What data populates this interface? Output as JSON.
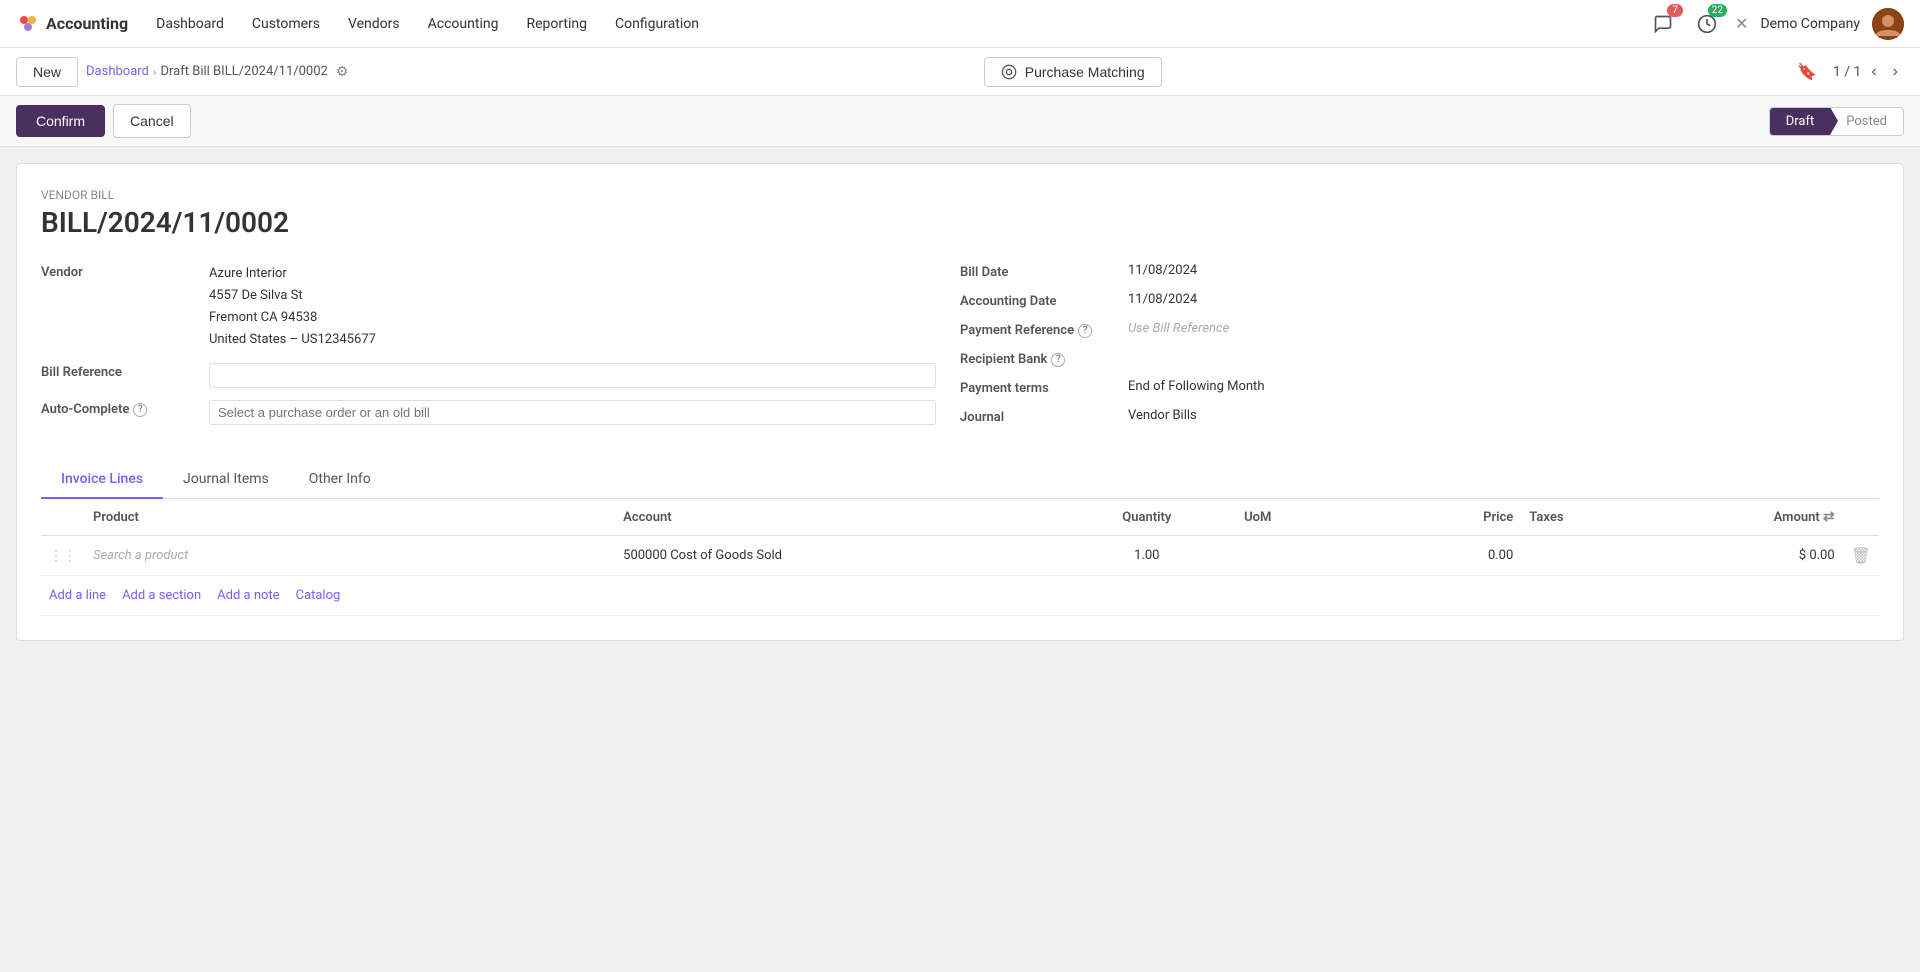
{
  "app": {
    "name": "Accounting",
    "logo": "📊"
  },
  "nav": {
    "items": [
      {
        "label": "Dashboard",
        "id": "dashboard"
      },
      {
        "label": "Customers",
        "id": "customers"
      },
      {
        "label": "Vendors",
        "id": "vendors"
      },
      {
        "label": "Accounting",
        "id": "accounting"
      },
      {
        "label": "Reporting",
        "id": "reporting"
      },
      {
        "label": "Configuration",
        "id": "configuration"
      }
    ],
    "notifications_count": "7",
    "messages_count": "22",
    "company": "Demo Company"
  },
  "breadcrumb": {
    "dashboard_label": "Dashboard",
    "current_label": "Draft Bill BILL/2024/11/0002",
    "new_button": "New",
    "pagination": "1 / 1"
  },
  "purchase_matching": {
    "label": "Purchase Matching"
  },
  "actions": {
    "confirm": "Confirm",
    "cancel": "Cancel"
  },
  "status": {
    "draft": "Draft",
    "posted": "Posted"
  },
  "document": {
    "type_label": "Vendor Bill",
    "bill_number": "BILL/2024/11/0002"
  },
  "vendor": {
    "label": "Vendor",
    "name": "Azure Interior",
    "address_line1": "4557 De Silva St",
    "address_line2": "Fremont CA 94538",
    "address_line3": "United States – US12345677"
  },
  "bill_reference": {
    "label": "Bill Reference"
  },
  "auto_complete": {
    "label": "Auto-Complete",
    "placeholder": "Select a purchase order or an old bill"
  },
  "right_fields": {
    "bill_date_label": "Bill Date",
    "bill_date_value": "11/08/2024",
    "accounting_date_label": "Accounting Date",
    "accounting_date_value": "11/08/2024",
    "payment_ref_label": "Payment Reference",
    "payment_ref_placeholder": "Use Bill Reference",
    "recipient_bank_label": "Recipient Bank",
    "payment_terms_label": "Payment terms",
    "payment_terms_value": "End of Following Month",
    "journal_label": "Journal",
    "journal_value": "Vendor Bills"
  },
  "tabs": {
    "invoice_lines": "Invoice Lines",
    "journal_items": "Journal Items",
    "other_info": "Other Info"
  },
  "table": {
    "headers": {
      "product": "Product",
      "account": "Account",
      "quantity": "Quantity",
      "uom": "UoM",
      "price": "Price",
      "taxes": "Taxes",
      "amount": "Amount"
    },
    "rows": [
      {
        "product": "Search a product",
        "account": "500000 Cost of Goods Sold",
        "quantity": "1.00",
        "uom": "",
        "price": "0.00",
        "taxes": "",
        "amount": "$ 0.00"
      }
    ]
  },
  "add_actions": {
    "add_line": "Add a line",
    "add_section": "Add a section",
    "add_note": "Add a note",
    "catalog": "Catalog"
  }
}
